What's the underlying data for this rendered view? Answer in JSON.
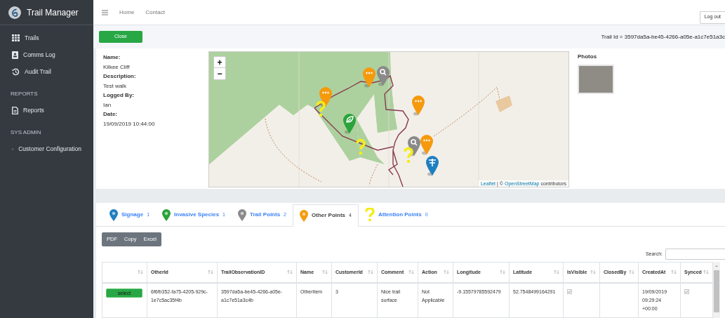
{
  "sidebar": {
    "brand": "Trail Manager",
    "sections": [
      {
        "items": [
          {
            "label": "Trails"
          },
          {
            "label": "Comms Log"
          },
          {
            "label": "Audit Trail"
          }
        ]
      },
      {
        "heading": "REPORTS",
        "items": [
          {
            "label": "Reports"
          }
        ]
      },
      {
        "heading": "SYS ADMIN",
        "items": [
          {
            "label": "Customer Configuration"
          }
        ]
      }
    ]
  },
  "topnav": {
    "links": [
      "Home",
      "Contact"
    ],
    "logout": "Log out"
  },
  "toolbar": {
    "close": "Close",
    "trail_id": "Trail Id = 3597da5a-be45-4266-a05e-a1c7e51a3c"
  },
  "details": [
    {
      "label": "Name:",
      "value": "Kilkee Cliff"
    },
    {
      "label": "Description:",
      "value": "Test walk"
    },
    {
      "label": "Logged By:",
      "value": "Ian"
    },
    {
      "label": "Date:",
      "value": "19/09/2019 10:44:00"
    }
  ],
  "map": {
    "zoom_in": "+",
    "zoom_out": "−",
    "attribution_link": "Leaflet",
    "attribution_sep": "|",
    "attribution_copy": "©",
    "attribution_osm": "OpenStreetMap",
    "attribution_rest": "contributors"
  },
  "photos": {
    "title": "Photos"
  },
  "tabs": [
    {
      "label": "Signage",
      "count": "1",
      "color": "#1e7fc0",
      "kind": "pin",
      "selected": false
    },
    {
      "label": "Invasive Species",
      "count": "1",
      "color": "#2aa33a",
      "kind": "pin",
      "selected": false
    },
    {
      "label": "Trail Points",
      "count": "2",
      "color": "#8a8a8a",
      "kind": "pin",
      "selected": false
    },
    {
      "label": "Other Points",
      "count": "4",
      "color": "#f59a0c",
      "kind": "pin",
      "selected": true
    },
    {
      "label": "Attention Points",
      "count": "0",
      "color": "#f5ec1a",
      "kind": "question",
      "selected": false
    }
  ],
  "export_buttons": [
    "PDF",
    "Copy",
    "Excel"
  ],
  "search": {
    "label": "Search:"
  },
  "table": {
    "columns": [
      "",
      "OtherId",
      "TrailObservationID",
      "Name",
      "CustomerId",
      "Comment",
      "Action",
      "Longitude",
      "Latitude",
      "IsVisible",
      "ClosedBy",
      "CreatedAt",
      "Synced"
    ],
    "rows": [
      {
        "cells": [
          {
            "kind": "button",
            "text": "select"
          },
          {
            "kind": "text",
            "text": "6f6fb352-fa75-4205-929c-1e7c5ac35f4b"
          },
          {
            "kind": "text",
            "text": "3597da5a-be45-4266-a05e-a1c7e51a3c4b"
          },
          {
            "kind": "text",
            "text": "OtherItem"
          },
          {
            "kind": "text",
            "text": "3"
          },
          {
            "kind": "text",
            "text": "Nice trail surface"
          },
          {
            "kind": "text",
            "text": "Not Applicable"
          },
          {
            "kind": "text",
            "text": "-9.15579785592479"
          },
          {
            "kind": "text",
            "text": "52.7548499164291"
          },
          {
            "kind": "check",
            "checked": true
          },
          {
            "kind": "blank"
          },
          {
            "kind": "text",
            "text": "19/09/2019 09:29:24 +00:00"
          },
          {
            "kind": "check",
            "checked": true
          }
        ]
      }
    ]
  }
}
